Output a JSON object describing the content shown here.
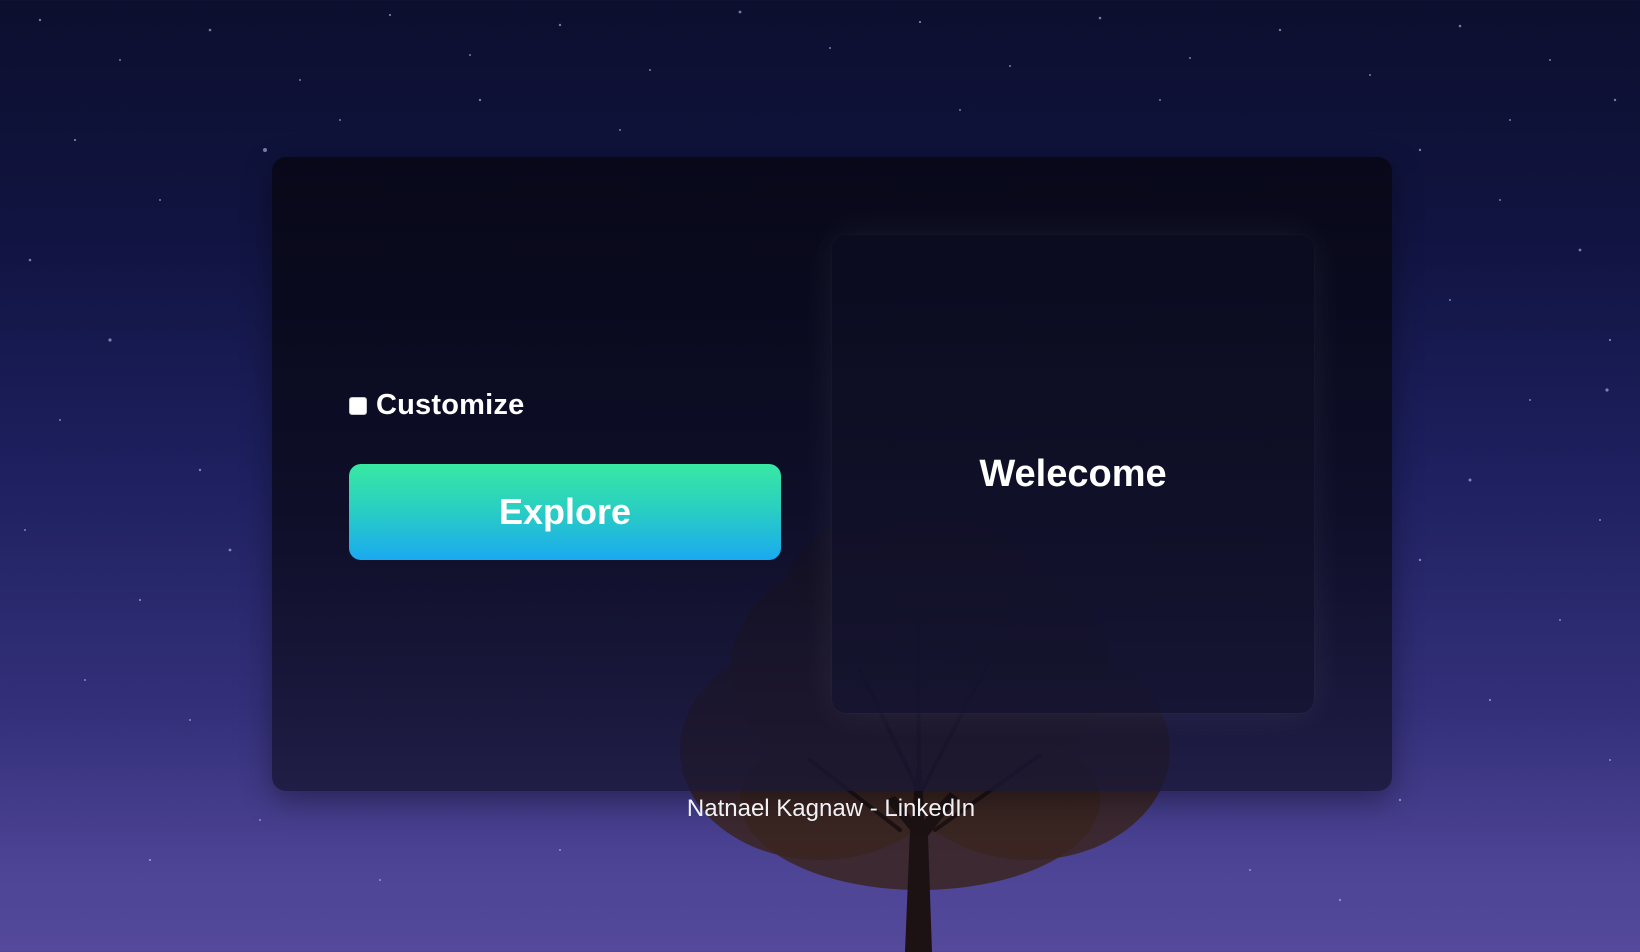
{
  "customize": {
    "label": "Customize",
    "checked": false
  },
  "explore_button": {
    "label": "Explore",
    "gradient_colors": [
      "#39e8a2",
      "#1aaaf0"
    ]
  },
  "welcome": {
    "text": "Welecome"
  },
  "footer": {
    "link_text": "Natnael Kagnaw - LinkedIn"
  },
  "colors": {
    "sky_top": "#0c0f2e",
    "sky_bottom": "#54499b",
    "card_background": "#0b0b20"
  }
}
